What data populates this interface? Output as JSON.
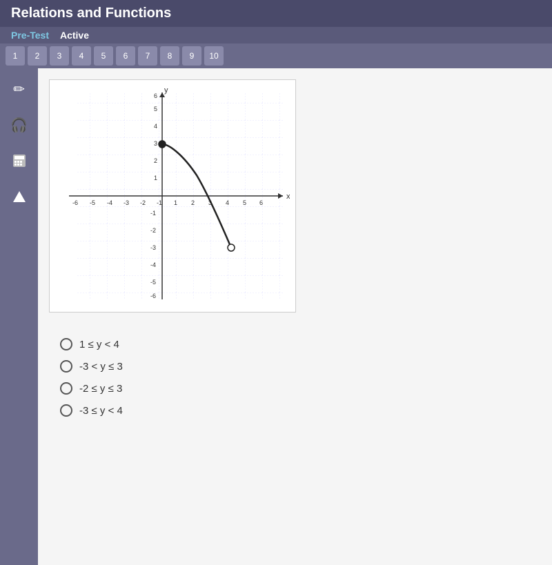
{
  "header": {
    "title": "Relations and Functions"
  },
  "subheader": {
    "pretest_label": "Pre-Test",
    "active_label": "Active"
  },
  "question_bar": {
    "numbers": [
      "1",
      "2",
      "3",
      "4",
      "5",
      "6",
      "7",
      "8",
      "9",
      "10"
    ]
  },
  "sidebar": {
    "icons": [
      {
        "name": "pencil-icon",
        "symbol": "✏"
      },
      {
        "name": "headphone-icon",
        "symbol": "🎧"
      },
      {
        "name": "calculator-icon",
        "symbol": "🖩"
      },
      {
        "name": "up-arrow-icon",
        "symbol": "↑"
      }
    ]
  },
  "graph": {
    "title": "coordinate-graph"
  },
  "choices": [
    {
      "id": "choice-1",
      "label": "1 ≤ y < 4"
    },
    {
      "id": "choice-2",
      "label": "-3 < y ≤ 3"
    },
    {
      "id": "choice-3",
      "label": "-2 ≤ y ≤ 3"
    },
    {
      "id": "choice-4",
      "label": "-3 ≤ y < 4"
    }
  ],
  "colors": {
    "accent": "#7ec8e3",
    "header_bg": "#4a4a6a",
    "sidebar_bg": "#6a6a8a"
  }
}
